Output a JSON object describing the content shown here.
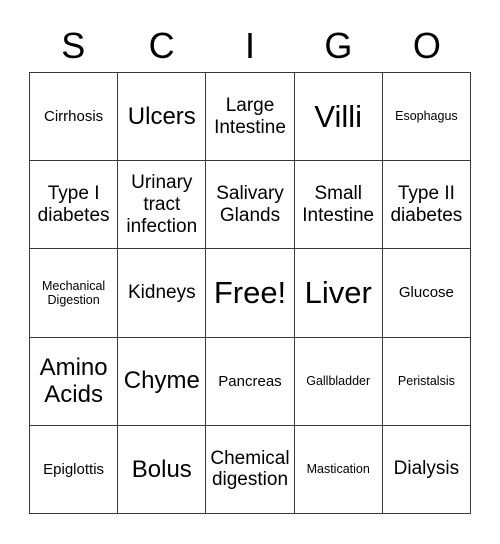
{
  "card": {
    "header_letters": [
      "S",
      "C",
      "I",
      "G",
      "O"
    ],
    "rows": [
      [
        {
          "label": "Cirrhosis",
          "size": "sm"
        },
        {
          "label": "Ulcers",
          "size": "lg"
        },
        {
          "label": "Large Intestine",
          "size": "md"
        },
        {
          "label": "Villi",
          "size": "xl"
        },
        {
          "label": "Esophagus",
          "size": "xs"
        }
      ],
      [
        {
          "label": "Type I diabetes",
          "size": "md"
        },
        {
          "label": "Urinary tract infection",
          "size": "md"
        },
        {
          "label": "Salivary Glands",
          "size": "md"
        },
        {
          "label": "Small Intestine",
          "size": "md"
        },
        {
          "label": "Type II diabetes",
          "size": "md"
        }
      ],
      [
        {
          "label": "Mechanical Digestion",
          "size": "xs"
        },
        {
          "label": "Kidneys",
          "size": "md"
        },
        {
          "label": "Free!",
          "size": "xl"
        },
        {
          "label": "Liver",
          "size": "xl"
        },
        {
          "label": "Glucose",
          "size": "sm"
        }
      ],
      [
        {
          "label": "Amino Acids",
          "size": "lg"
        },
        {
          "label": "Chyme",
          "size": "lg"
        },
        {
          "label": "Pancreas",
          "size": "sm"
        },
        {
          "label": "Gallbladder",
          "size": "xs"
        },
        {
          "label": "Peristalsis",
          "size": "xs"
        }
      ],
      [
        {
          "label": "Epiglottis",
          "size": "sm"
        },
        {
          "label": "Bolus",
          "size": "lg"
        },
        {
          "label": "Chemical digestion",
          "size": "md"
        },
        {
          "label": "Mastication",
          "size": "xs"
        },
        {
          "label": "Dialysis",
          "size": "md"
        }
      ]
    ],
    "colors": {
      "background": "#ffffff",
      "border": "#3a3a3a",
      "text": "#000000"
    }
  }
}
